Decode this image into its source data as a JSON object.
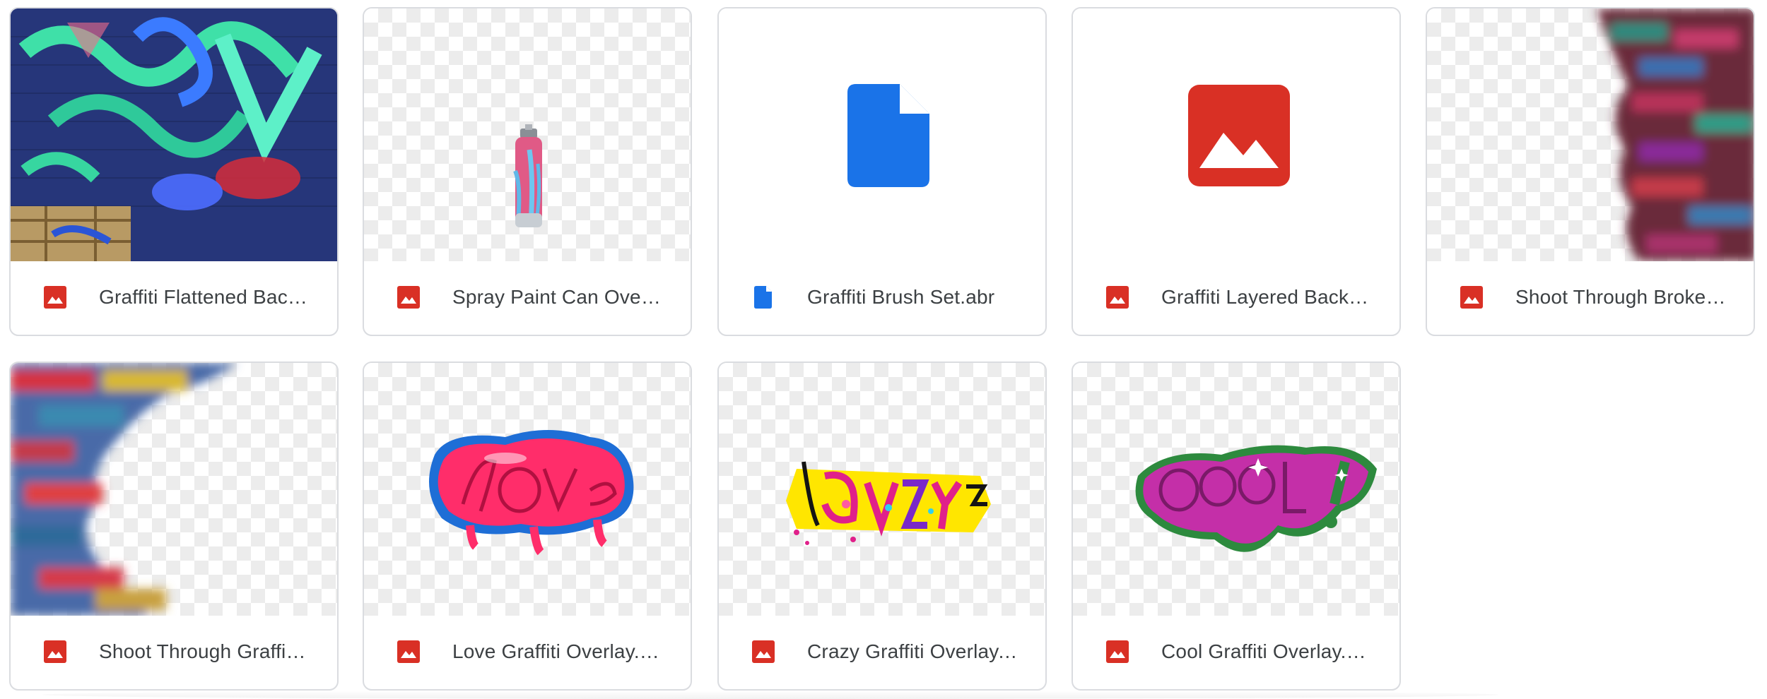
{
  "files": [
    {
      "name": "Graffiti Flattened Back…",
      "type": "image",
      "icon": "image-file-icon",
      "thumb": "graffiti-wall-photo"
    },
    {
      "name": "Spray Paint Can Overla…",
      "type": "image",
      "icon": "image-file-icon",
      "thumb": "spray-can"
    },
    {
      "name": "Graffiti Brush Set.abr",
      "type": "document",
      "icon": "document-file-icon",
      "thumb": "document-icon"
    },
    {
      "name": "Graffiti Layered Backgr…",
      "type": "image",
      "icon": "image-file-icon",
      "thumb": "image-icon"
    },
    {
      "name": "Shoot Through Broken …",
      "type": "image",
      "icon": "image-file-icon",
      "thumb": "brick-edge-right"
    },
    {
      "name": "Shoot Through Graffiti …",
      "type": "image",
      "icon": "image-file-icon",
      "thumb": "brick-edge-left"
    },
    {
      "name": "Love Graffiti Overlay.png",
      "type": "image",
      "icon": "image-file-icon",
      "thumb": "love-graffiti"
    },
    {
      "name": "Crazy Graffiti Overlay.p…",
      "type": "image",
      "icon": "image-file-icon",
      "thumb": "crazy-graffiti"
    },
    {
      "name": "Cool Graffiti Overlay.png",
      "type": "image",
      "icon": "image-file-icon",
      "thumb": "cool-graffiti"
    }
  ],
  "colors": {
    "image_icon": "#d93025",
    "doc_icon": "#1a73e8",
    "card_border": "#dadce0",
    "text": "#3c4043"
  }
}
